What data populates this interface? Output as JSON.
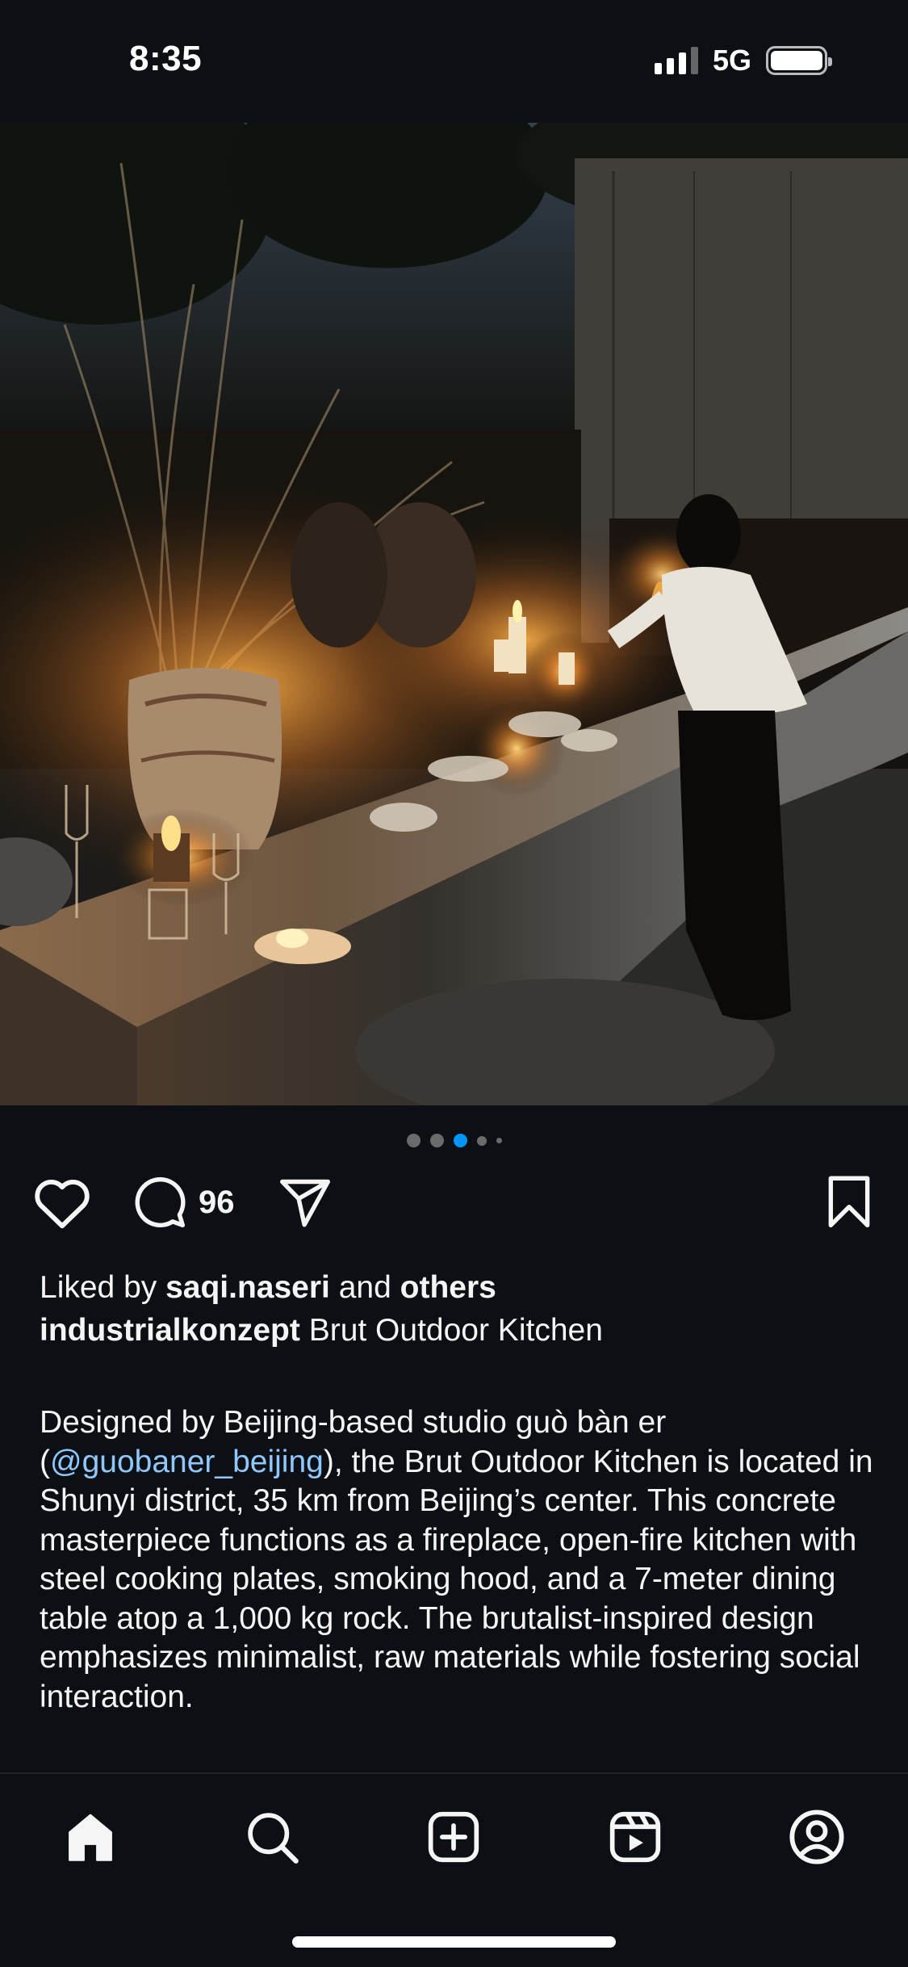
{
  "status_bar": {
    "time": "8:35",
    "network": "5G",
    "icons": [
      "signal-bars-icon",
      "battery-icon"
    ]
  },
  "post": {
    "image_alt": "Brut Outdoor Kitchen at dusk with candles on a long concrete dining table",
    "carousel": {
      "count": 5,
      "active_index": 2
    },
    "actions": {
      "like_icon": "heart-outline-icon",
      "comment_icon": "comment-bubble-icon",
      "comment_count": "96",
      "share_icon": "paper-plane-icon",
      "save_icon": "bookmark-outline-icon"
    },
    "likes": {
      "prefix": "Liked by ",
      "user": "saqi.naseri",
      "middle": " and ",
      "others": "others"
    },
    "caption": {
      "username": "industrialkonzept",
      "title": " Brut Outdoor Kitchen",
      "body_line1": "Designed by Beijing-based studio guò bàn er",
      "body_open_paren": "(",
      "mention": "@guobaner_beijing",
      "body_line2_rest": "), the Brut Outdoor Kitchen is",
      "body_rest": "located in Shunyi district, 35 km from Beijing’s center. This concrete masterpiece functions as a fireplace, open-fire kitchen with steel cooking plates, smoking hood, and a 7-meter dining table atop a 1,000 kg rock. The brutalist-inspired design emphasizes minimalist, raw materials while fostering social interaction."
    }
  },
  "bottom_nav": {
    "items": [
      {
        "name": "home",
        "icon": "home-filled-icon"
      },
      {
        "name": "search",
        "icon": "search-icon"
      },
      {
        "name": "create",
        "icon": "plus-square-icon"
      },
      {
        "name": "reels",
        "icon": "reels-icon"
      },
      {
        "name": "profile",
        "icon": "profile-avatar-icon"
      }
    ]
  },
  "colors": {
    "background": "#0c1014",
    "text": "#f5f5f5",
    "mention": "#8fc8ff",
    "active_dot": "#0095f6"
  }
}
